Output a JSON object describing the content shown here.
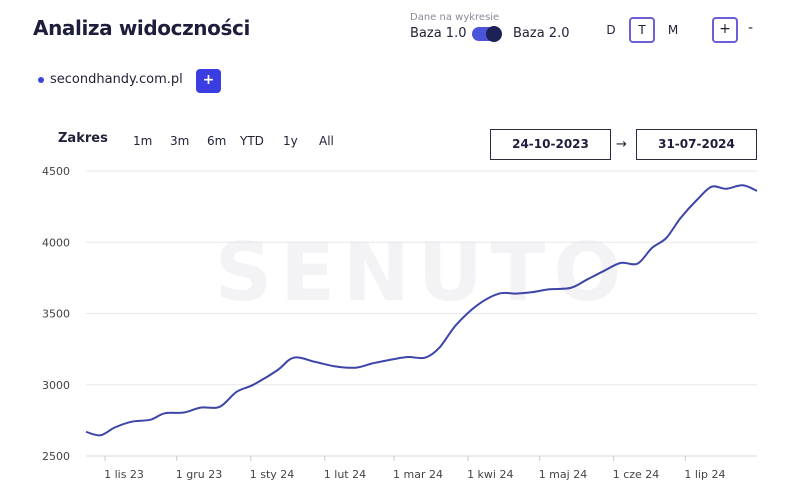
{
  "header": {
    "title": "Analiza widoczności",
    "toggle_caption": "Dane na wykresie",
    "base_left": "Baza 1.0",
    "base_right": "Baza 2.0",
    "periods": [
      "D",
      "T",
      "M"
    ],
    "active_period": "T",
    "zoom_in": "+",
    "zoom_out": "-"
  },
  "domains": {
    "items": [
      "secondhandy.com.pl"
    ],
    "add_label": "+",
    "series_color": "#3b46d6"
  },
  "range": {
    "label": "Zakres",
    "buttons": [
      "1m",
      "3m",
      "6m",
      "YTD",
      "1y",
      "All"
    ],
    "date_from": "24-10-2023",
    "arrow": "→",
    "date_to": "31-07-2024"
  },
  "watermark": "SENUTO",
  "chart_data": {
    "type": "line",
    "title": "",
    "xlabel": "",
    "ylabel": "",
    "ylim": [
      2500,
      4500
    ],
    "yticks": [
      2500,
      3000,
      3500,
      4000,
      4500
    ],
    "xlim": [
      "2023-10-24",
      "2024-07-31"
    ],
    "xticks": [
      {
        "date": "2023-11-01",
        "label": "1 lis 23"
      },
      {
        "date": "2023-12-01",
        "label": "1 gru 23"
      },
      {
        "date": "2024-01-01",
        "label": "1 sty 24"
      },
      {
        "date": "2024-02-01",
        "label": "1 lut 24"
      },
      {
        "date": "2024-03-01",
        "label": "1 mar 24"
      },
      {
        "date": "2024-04-01",
        "label": "1 kwi 24"
      },
      {
        "date": "2024-05-01",
        "label": "1 maj 24"
      },
      {
        "date": "2024-06-01",
        "label": "1 cze 24"
      },
      {
        "date": "2024-07-01",
        "label": "1 lip 24"
      }
    ],
    "grid": true,
    "series": [
      {
        "color": "#3d45a8",
        "points": [
          {
            "x": "2023-10-24",
            "y": 2670
          },
          {
            "x": "2023-10-30",
            "y": 2645
          },
          {
            "x": "2023-11-05",
            "y": 2700
          },
          {
            "x": "2023-11-12",
            "y": 2740
          },
          {
            "x": "2023-11-20",
            "y": 2755
          },
          {
            "x": "2023-11-26",
            "y": 2800
          },
          {
            "x": "2023-12-04",
            "y": 2805
          },
          {
            "x": "2023-12-11",
            "y": 2840
          },
          {
            "x": "2023-12-19",
            "y": 2845
          },
          {
            "x": "2023-12-26",
            "y": 2950
          },
          {
            "x": "2024-01-02",
            "y": 3000
          },
          {
            "x": "2024-01-12",
            "y": 3100
          },
          {
            "x": "2024-01-19",
            "y": 3190
          },
          {
            "x": "2024-01-28",
            "y": 3160
          },
          {
            "x": "2024-02-05",
            "y": 3130
          },
          {
            "x": "2024-02-14",
            "y": 3120
          },
          {
            "x": "2024-02-21",
            "y": 3150
          },
          {
            "x": "2024-03-01",
            "y": 3180
          },
          {
            "x": "2024-03-07",
            "y": 3195
          },
          {
            "x": "2024-03-14",
            "y": 3190
          },
          {
            "x": "2024-03-20",
            "y": 3260
          },
          {
            "x": "2024-03-27",
            "y": 3420
          },
          {
            "x": "2024-04-05",
            "y": 3560
          },
          {
            "x": "2024-04-14",
            "y": 3640
          },
          {
            "x": "2024-04-21",
            "y": 3640
          },
          {
            "x": "2024-04-28",
            "y": 3650
          },
          {
            "x": "2024-05-05",
            "y": 3670
          },
          {
            "x": "2024-05-14",
            "y": 3680
          },
          {
            "x": "2024-05-21",
            "y": 3740
          },
          {
            "x": "2024-05-28",
            "y": 3800
          },
          {
            "x": "2024-06-04",
            "y": 3855
          },
          {
            "x": "2024-06-11",
            "y": 3850
          },
          {
            "x": "2024-06-17",
            "y": 3960
          },
          {
            "x": "2024-06-23",
            "y": 4030
          },
          {
            "x": "2024-06-29",
            "y": 4170
          },
          {
            "x": "2024-07-06",
            "y": 4300
          },
          {
            "x": "2024-07-12",
            "y": 4390
          },
          {
            "x": "2024-07-18",
            "y": 4375
          },
          {
            "x": "2024-07-25",
            "y": 4400
          },
          {
            "x": "2024-07-31",
            "y": 4360
          }
        ]
      }
    ]
  }
}
